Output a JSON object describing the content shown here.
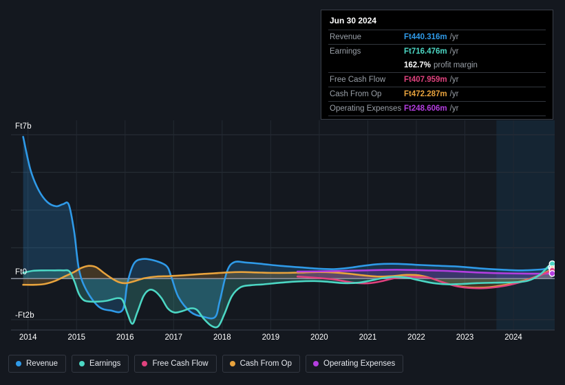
{
  "tooltip": {
    "date": "Jun 30 2024",
    "rows": [
      {
        "name": "Revenue",
        "value": "Ft440.316m",
        "unit": "/yr",
        "color": "#2f9ae8"
      },
      {
        "name": "Earnings",
        "value": "Ft716.476m",
        "unit": "/yr",
        "color": "#4cd7c4"
      },
      {
        "name": "",
        "value": "162.7%",
        "unit": "profit margin",
        "color": "#ffffff"
      },
      {
        "name": "Free Cash Flow",
        "value": "Ft407.959m",
        "unit": "/yr",
        "color": "#e0427e"
      },
      {
        "name": "Cash From Op",
        "value": "Ft472.287m",
        "unit": "/yr",
        "color": "#e8a33d"
      },
      {
        "name": "Operating Expenses",
        "value": "Ft248.606m",
        "unit": "/yr",
        "color": "#b43ee0"
      }
    ]
  },
  "legend": {
    "items": [
      {
        "label": "Revenue",
        "color": "#2f9ae8"
      },
      {
        "label": "Earnings",
        "color": "#4cd7c4"
      },
      {
        "label": "Free Cash Flow",
        "color": "#e0427e"
      },
      {
        "label": "Cash From Op",
        "color": "#e8a33d"
      },
      {
        "label": "Operating Expenses",
        "color": "#b43ee0"
      }
    ]
  },
  "chart_data": {
    "type": "line",
    "title": "",
    "xlabel": "",
    "ylabel": "",
    "currency_prefix": "Ft",
    "grid": true,
    "legend_position": "bottom",
    "x": [
      2014,
      2015,
      2016,
      2017,
      2018,
      2019,
      2020,
      2021,
      2022,
      2023,
      2024
    ],
    "xlim": [
      2013.65,
      2024.85
    ],
    "ylim": [
      -2.4,
      7.6
    ],
    "yticks": [
      -2,
      0,
      7
    ],
    "ytick_labels": [
      "-Ft2b",
      "Ft0",
      "Ft7b"
    ],
    "xtick_labels": [
      "2014",
      "2015",
      "2016",
      "2017",
      "2018",
      "2019",
      "2020",
      "2021",
      "2022",
      "2023",
      "2024"
    ],
    "units": "billions of Ft (b = 1e9, m = 1e6)",
    "forecast_region": {
      "start": 2023.65,
      "end": 2024.85,
      "shaded": true
    },
    "series": [
      {
        "name": "Revenue",
        "color": "#2f9ae8",
        "area": true,
        "points": [
          [
            2013.9,
            6.9
          ],
          [
            2014.05,
            5.3
          ],
          [
            2014.22,
            4.3
          ],
          [
            2014.4,
            3.72
          ],
          [
            2014.58,
            3.52
          ],
          [
            2014.72,
            3.62
          ],
          [
            2014.84,
            3.6
          ],
          [
            2014.95,
            2.3
          ],
          [
            2015.05,
            0.45
          ],
          [
            2015.2,
            -0.55
          ],
          [
            2015.45,
            -1.35
          ],
          [
            2015.7,
            -1.55
          ],
          [
            2015.95,
            -1.52
          ],
          [
            2016.05,
            -0.2
          ],
          [
            2016.18,
            0.72
          ],
          [
            2016.35,
            0.95
          ],
          [
            2016.6,
            0.88
          ],
          [
            2016.85,
            0.62
          ],
          [
            2016.95,
            0.1
          ],
          [
            2017.1,
            -0.9
          ],
          [
            2017.35,
            -1.62
          ],
          [
            2017.6,
            -1.85
          ],
          [
            2017.85,
            -1.88
          ],
          [
            2017.95,
            -1.1
          ],
          [
            2018.1,
            0.35
          ],
          [
            2018.25,
            0.8
          ],
          [
            2018.5,
            0.78
          ],
          [
            2018.8,
            0.72
          ],
          [
            2019.2,
            0.62
          ],
          [
            2019.6,
            0.55
          ],
          [
            2020.0,
            0.48
          ],
          [
            2020.3,
            0.46
          ],
          [
            2020.6,
            0.52
          ],
          [
            2020.9,
            0.62
          ],
          [
            2021.2,
            0.7
          ],
          [
            2021.5,
            0.72
          ],
          [
            2021.8,
            0.7
          ],
          [
            2022.1,
            0.66
          ],
          [
            2022.5,
            0.62
          ],
          [
            2022.9,
            0.58
          ],
          [
            2023.3,
            0.5
          ],
          [
            2023.7,
            0.44
          ],
          [
            2024.1,
            0.4
          ],
          [
            2024.4,
            0.42
          ],
          [
            2024.62,
            0.46
          ],
          [
            2024.78,
            0.55
          ]
        ]
      },
      {
        "name": "Earnings",
        "color": "#4cd7c4",
        "area": true,
        "points": [
          [
            2013.9,
            0.28
          ],
          [
            2014.1,
            0.38
          ],
          [
            2014.32,
            0.4
          ],
          [
            2014.55,
            0.4
          ],
          [
            2014.72,
            0.4
          ],
          [
            2014.85,
            0.36
          ],
          [
            2014.95,
            -0.1
          ],
          [
            2015.05,
            -0.75
          ],
          [
            2015.15,
            -1.05
          ],
          [
            2015.28,
            -1.12
          ],
          [
            2015.45,
            -1.12
          ],
          [
            2015.62,
            -1.08
          ],
          [
            2015.75,
            -1.0
          ],
          [
            2015.85,
            -0.95
          ],
          [
            2015.95,
            -1.05
          ],
          [
            2016.05,
            -1.7
          ],
          [
            2016.15,
            -2.2
          ],
          [
            2016.25,
            -1.65
          ],
          [
            2016.38,
            -0.85
          ],
          [
            2016.5,
            -0.55
          ],
          [
            2016.62,
            -0.62
          ],
          [
            2016.75,
            -0.95
          ],
          [
            2016.88,
            -1.45
          ],
          [
            2017.02,
            -1.65
          ],
          [
            2017.18,
            -1.58
          ],
          [
            2017.35,
            -1.45
          ],
          [
            2017.48,
            -1.52
          ],
          [
            2017.62,
            -1.95
          ],
          [
            2017.78,
            -2.3
          ],
          [
            2017.92,
            -2.32
          ],
          [
            2018.05,
            -1.7
          ],
          [
            2018.2,
            -0.85
          ],
          [
            2018.38,
            -0.42
          ],
          [
            2018.6,
            -0.32
          ],
          [
            2018.85,
            -0.28
          ],
          [
            2019.2,
            -0.2
          ],
          [
            2019.55,
            -0.14
          ],
          [
            2019.9,
            -0.12
          ],
          [
            2020.2,
            -0.16
          ],
          [
            2020.5,
            -0.22
          ],
          [
            2020.8,
            -0.2
          ],
          [
            2021.05,
            -0.1
          ],
          [
            2021.3,
            0.02
          ],
          [
            2021.55,
            0.08
          ],
          [
            2021.8,
            0.05
          ],
          [
            2022.05,
            -0.08
          ],
          [
            2022.35,
            -0.22
          ],
          [
            2022.65,
            -0.28
          ],
          [
            2022.95,
            -0.26
          ],
          [
            2023.25,
            -0.22
          ],
          [
            2023.6,
            -0.2
          ],
          [
            2024.0,
            -0.18
          ],
          [
            2024.3,
            -0.1
          ],
          [
            2024.55,
            0.2
          ],
          [
            2024.72,
            0.6
          ],
          [
            2024.8,
            0.72
          ]
        ]
      },
      {
        "name": "Cash From Op",
        "color": "#e8a33d",
        "area": true,
        "points": [
          [
            2013.9,
            -0.3
          ],
          [
            2014.15,
            -0.3
          ],
          [
            2014.35,
            -0.26
          ],
          [
            2014.55,
            -0.12
          ],
          [
            2014.75,
            0.1
          ],
          [
            2014.95,
            0.32
          ],
          [
            2015.1,
            0.52
          ],
          [
            2015.25,
            0.62
          ],
          [
            2015.4,
            0.56
          ],
          [
            2015.55,
            0.3
          ],
          [
            2015.72,
            0.02
          ],
          [
            2015.88,
            -0.18
          ],
          [
            2016.02,
            -0.22
          ],
          [
            2016.2,
            -0.12
          ],
          [
            2016.4,
            0.02
          ],
          [
            2016.65,
            0.1
          ],
          [
            2016.9,
            0.12
          ],
          [
            2017.2,
            0.16
          ],
          [
            2017.55,
            0.22
          ],
          [
            2017.85,
            0.26
          ],
          [
            2018.1,
            0.3
          ],
          [
            2018.4,
            0.32
          ],
          [
            2018.7,
            0.3
          ],
          [
            2019.0,
            0.28
          ],
          [
            2019.35,
            0.28
          ],
          [
            2019.7,
            0.3
          ],
          [
            2020.0,
            0.32
          ],
          [
            2020.3,
            0.3
          ],
          [
            2020.6,
            0.24
          ],
          [
            2020.9,
            0.16
          ],
          [
            2021.2,
            0.1
          ],
          [
            2021.5,
            0.12
          ],
          [
            2021.8,
            0.18
          ],
          [
            2022.05,
            0.16
          ],
          [
            2022.3,
            0.02
          ],
          [
            2022.6,
            -0.22
          ],
          [
            2022.9,
            -0.38
          ],
          [
            2023.2,
            -0.44
          ],
          [
            2023.5,
            -0.42
          ],
          [
            2023.85,
            -0.3
          ],
          [
            2024.15,
            -0.14
          ],
          [
            2024.45,
            0.08
          ],
          [
            2024.68,
            0.32
          ],
          [
            2024.8,
            0.48
          ]
        ]
      },
      {
        "name": "Free Cash Flow",
        "color": "#e0427e",
        "area": false,
        "starts_at": 2019.55,
        "points": [
          [
            2019.55,
            0.1
          ],
          [
            2019.8,
            0.06
          ],
          [
            2020.05,
            0.02
          ],
          [
            2020.3,
            -0.04
          ],
          [
            2020.55,
            -0.14
          ],
          [
            2020.8,
            -0.22
          ],
          [
            2021.05,
            -0.22
          ],
          [
            2021.3,
            -0.12
          ],
          [
            2021.55,
            0.02
          ],
          [
            2021.8,
            0.08
          ],
          [
            2022.05,
            0.08
          ],
          [
            2022.3,
            0.02
          ],
          [
            2022.55,
            -0.18
          ],
          [
            2022.85,
            -0.38
          ],
          [
            2023.15,
            -0.46
          ],
          [
            2023.45,
            -0.46
          ],
          [
            2023.8,
            -0.36
          ],
          [
            2024.1,
            -0.2
          ],
          [
            2024.4,
            0.02
          ],
          [
            2024.65,
            0.26
          ],
          [
            2024.8,
            0.41
          ]
        ]
      },
      {
        "name": "Operating Expenses",
        "color": "#b43ee0",
        "area": true,
        "starts_at": 2019.55,
        "points": [
          [
            2019.55,
            0.34
          ],
          [
            2019.9,
            0.35
          ],
          [
            2020.25,
            0.36
          ],
          [
            2020.6,
            0.38
          ],
          [
            2020.95,
            0.4
          ],
          [
            2021.3,
            0.42
          ],
          [
            2021.6,
            0.43
          ],
          [
            2021.9,
            0.42
          ],
          [
            2022.2,
            0.4
          ],
          [
            2022.55,
            0.38
          ],
          [
            2022.9,
            0.34
          ],
          [
            2023.25,
            0.3
          ],
          [
            2023.6,
            0.27
          ],
          [
            2024.0,
            0.25
          ],
          [
            2024.35,
            0.24
          ],
          [
            2024.6,
            0.24
          ],
          [
            2024.8,
            0.25
          ]
        ]
      }
    ],
    "markers_at_end": [
      {
        "name": "Earnings",
        "color": "#4cd7c4"
      },
      {
        "name": "Cash From Op",
        "color": "#e8a33d"
      },
      {
        "name": "Revenue",
        "color": "#2f9ae8"
      },
      {
        "name": "Free Cash Flow",
        "color": "#e0427e"
      },
      {
        "name": "Operating Expenses",
        "color": "#b43ee0"
      }
    ]
  }
}
